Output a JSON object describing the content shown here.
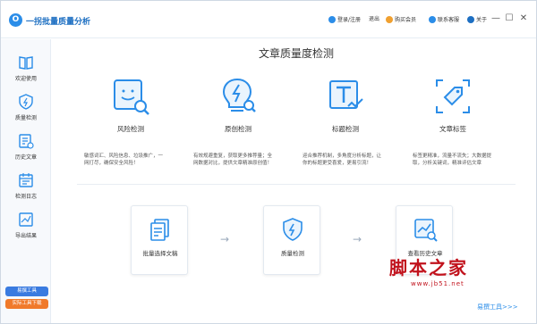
{
  "app": {
    "title": "一拐批量质量分析",
    "logo_glyph": "O"
  },
  "toolbar": {
    "login": "登录/注册",
    "logout": "退出",
    "buy": "购买会员",
    "service": "联系客服",
    "about": "关于"
  },
  "window": {
    "minimize": "—",
    "maximize": "☐",
    "close": "✕"
  },
  "sidebar": {
    "items": [
      {
        "label": "欢迎使用",
        "icon": "book-icon"
      },
      {
        "label": "质量检测",
        "icon": "shield-icon"
      },
      {
        "label": "历史文章",
        "icon": "document-icon"
      },
      {
        "label": "检测日志",
        "icon": "calendar-icon"
      },
      {
        "label": "导出结果",
        "icon": "chart-icon"
      }
    ],
    "chip1": "易撰工具",
    "chip2": "实际工具下载"
  },
  "main": {
    "title": "文章质量度检测",
    "features": [
      {
        "label": "风险检测",
        "desc": "敏感词汇、风险信息、垃圾推广，一网打尽，确保安全风险！"
      },
      {
        "label": "原创检测",
        "desc": "有效规避重复，获取更多推荐量；全网数据对比，提供文章精准原创值！"
      },
      {
        "label": "标题检测",
        "desc": "迎合推荐机制，多角度分析标题，让你的标题更受喜爱，更易引流！"
      },
      {
        "label": "文章标签",
        "desc": "标签更精准，流量不流失；大数据提取，分析关键词，精准评估文章"
      }
    ],
    "steps": [
      {
        "label": "批量选择文稿"
      },
      {
        "label": "质量检测"
      },
      {
        "label": "查看历史文章"
      }
    ],
    "arrow": "→"
  },
  "footer": {
    "link": "易撰工具>>>"
  },
  "watermark": {
    "text": "脚本之家",
    "url": "www.jb51.net"
  },
  "colors": {
    "accent": "#2b8de8",
    "watermark": "#c1121c",
    "chip_blue": "#3a7be0",
    "chip_orange": "#f07a2a"
  }
}
